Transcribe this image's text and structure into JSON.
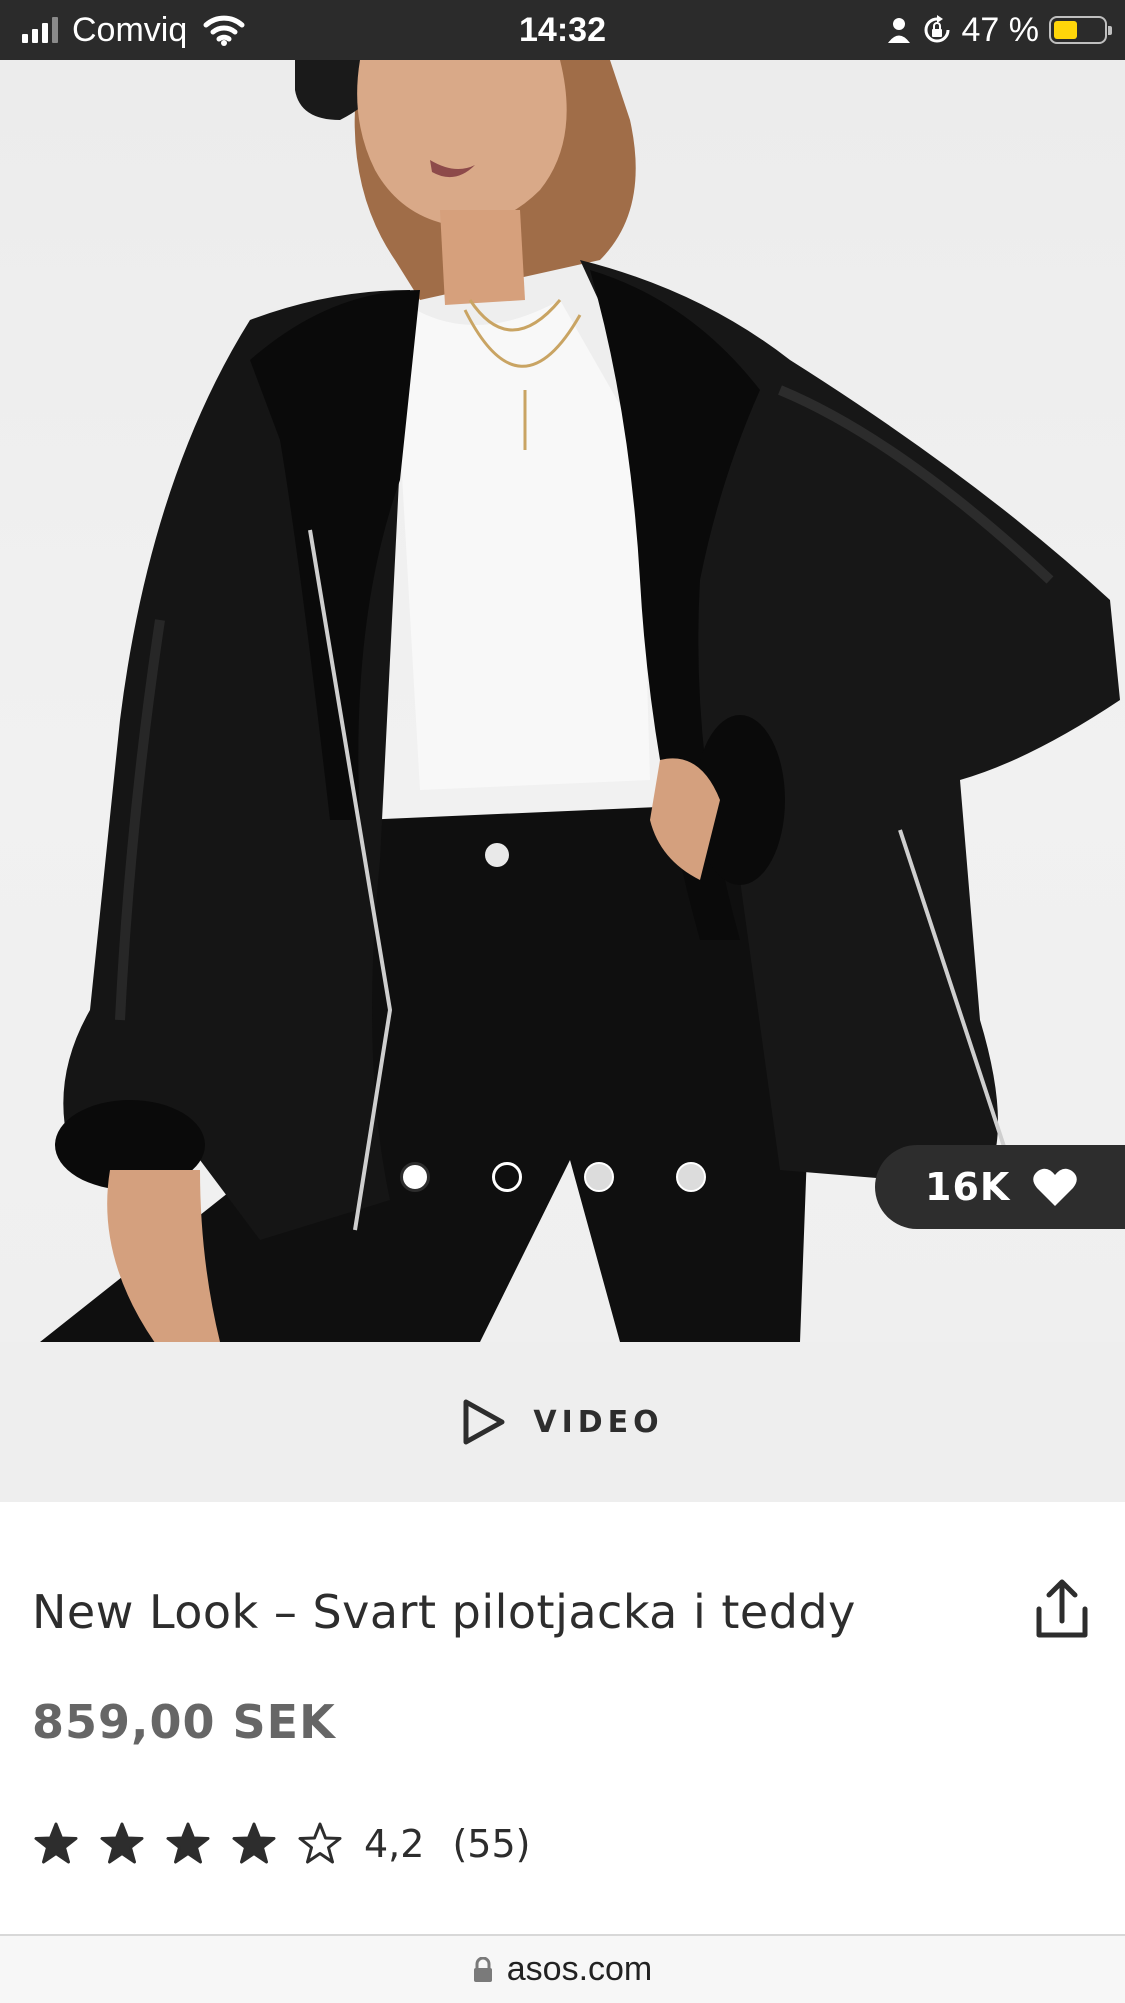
{
  "status_bar": {
    "carrier": "Comviq",
    "time": "14:32",
    "battery": "47 %",
    "battery_level": 0.47
  },
  "product": {
    "image_alt": "New Look – Svart pilotjacka i teddy",
    "carousel_total": 4,
    "carousel_active": 1,
    "saves": "16K",
    "video_label": "VIDEO",
    "title": "New Look – Svart pilotjacka i teddy",
    "price": "859,00 SEK",
    "rating": {
      "stars_filled": 4,
      "stars_total": 5,
      "value": "4,2",
      "count": "(55)"
    }
  },
  "browser": {
    "url": "asos.com"
  },
  "icons": {
    "signal": "signal-bars-icon",
    "wifi": "wifi-icon",
    "person": "person-icon",
    "rotation_lock": "rotation-lock-icon",
    "battery": "battery-icon",
    "heart": "heart-icon",
    "play": "play-icon",
    "share": "share-icon",
    "star": "star-icon",
    "lock": "lock-icon"
  },
  "colors": {
    "status_bar": "#2b2b2b",
    "text_dark": "#2d2d2d",
    "price": "#666666",
    "battery_fill": "#ffd60a",
    "video_strip": "#eeeeee"
  }
}
